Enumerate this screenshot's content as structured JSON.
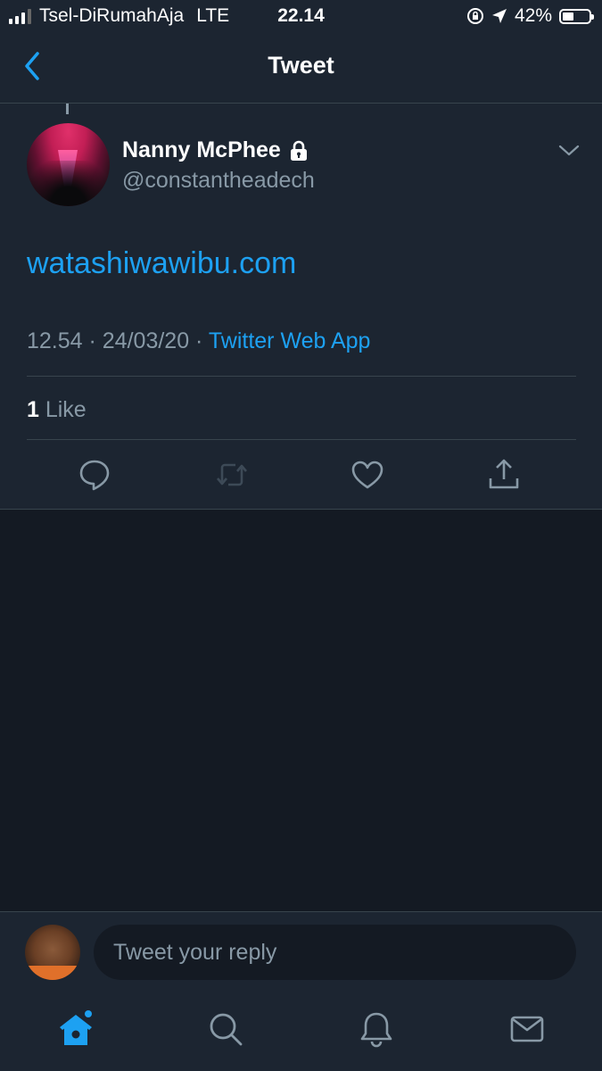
{
  "status_bar": {
    "carrier": "Tsel-DiRumahAja",
    "network": "LTE",
    "time": "22.14",
    "battery": "42%",
    "battery_level": 0.42
  },
  "nav": {
    "title": "Tweet"
  },
  "tweet": {
    "author_name": "Nanny McPhee",
    "handle": "@constantheadech",
    "protected": true,
    "text": "watashiwawibu.com",
    "time": "12.54",
    "date": "24/03/20",
    "separator": " · ",
    "source": "Twitter Web App",
    "like_count": "1",
    "like_label": " Like"
  },
  "actions": [
    "reply-icon",
    "retweet-icon",
    "like-icon",
    "share-icon"
  ],
  "reply_bar": {
    "placeholder": "Tweet your reply"
  },
  "tab_bar": [
    "home-icon",
    "search-icon",
    "notifications-icon",
    "messages-icon"
  ],
  "colors": {
    "accent": "#1da1f2",
    "background": "#141a23",
    "surface": "#1c2531",
    "secondary_text": "#8899a6",
    "divider": "#38444d"
  }
}
